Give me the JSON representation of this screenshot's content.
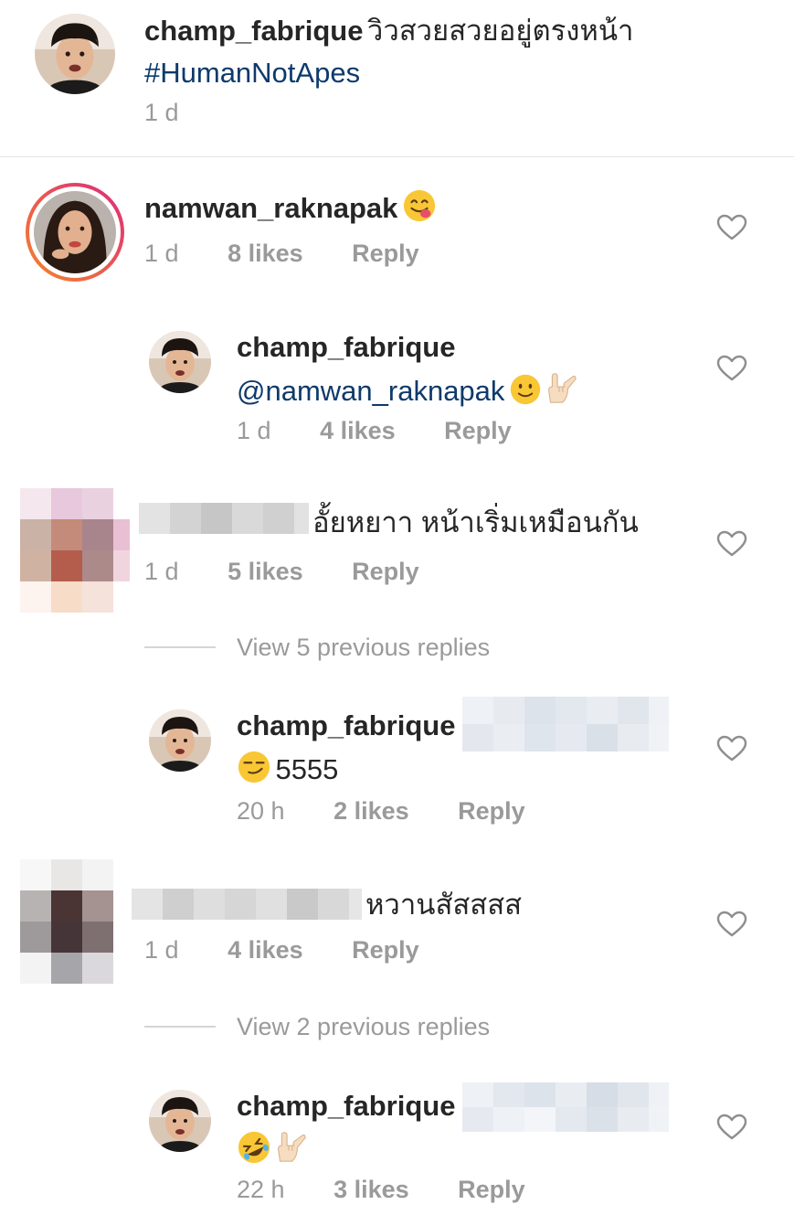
{
  "caption": {
    "username": "champ_fabrique",
    "text": "วิวสวยสวยอยู่ตรงหน้า",
    "hashtag": "#HumanNotApes",
    "time": "1 d"
  },
  "comments": [
    {
      "username": "namwan_raknapak",
      "time": "1 d",
      "likes": "8 likes",
      "reply": "Reply"
    },
    {
      "username": "champ_fabrique",
      "mention": "@namwan_raknapak",
      "time": "1 d",
      "likes": "4 likes",
      "reply": "Reply"
    },
    {
      "text": "อั้ยหยาา หน้าเริ่มเหมือนกัน",
      "time": "1 d",
      "likes": "5 likes",
      "reply": "Reply"
    },
    {
      "view_replies": "View 5 previous replies"
    },
    {
      "username": "champ_fabrique",
      "text": "5555",
      "time": "20 h",
      "likes": "2 likes",
      "reply": "Reply"
    },
    {
      "text": "หวานสัสสสส",
      "time": "1 d",
      "likes": "4 likes",
      "reply": "Reply"
    },
    {
      "view_replies": "View 2 previous replies"
    },
    {
      "username": "champ_fabrique",
      "time": "22 h",
      "likes": "3 likes",
      "reply": "Reply"
    }
  ],
  "colors": {
    "text": "#262626",
    "muted": "#9a9a9a",
    "link": "#0e3a6b",
    "story_ring_start": "#f58529",
    "story_ring_end": "#dd2a7b"
  },
  "icons": [
    "heart-icon",
    "emoji-yum-icon",
    "emoji-smile-icon",
    "emoji-love-you-gesture-icon",
    "emoji-smirk-icon",
    "emoji-rofl-icon"
  ]
}
